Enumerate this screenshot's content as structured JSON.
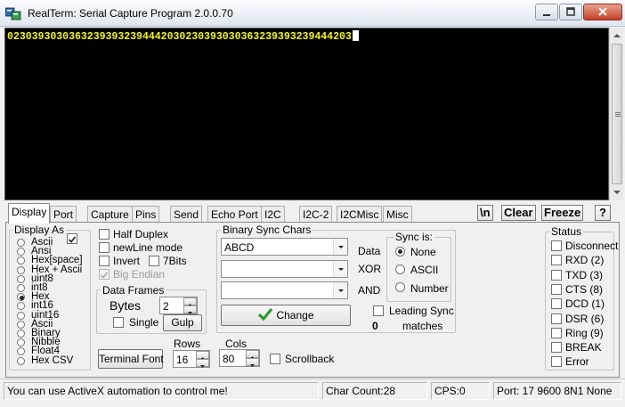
{
  "window": {
    "title": "RealTerm: Serial Capture Program 2.0.0.70"
  },
  "terminal": {
    "text": "02303930303632393932394442030230393030363239393239444203"
  },
  "tabs": [
    "Display",
    "Port",
    "Capture",
    "Pins",
    "Send",
    "Echo Port",
    "I2C",
    "I2C-2",
    "I2CMisc",
    "Misc"
  ],
  "toolbar": {
    "newline_label": "\\n",
    "clear_label": "Clear",
    "freeze_label": "Freeze",
    "help_label": "?"
  },
  "display_as": {
    "title": "Display As",
    "options": [
      "Ascii",
      "Ansi",
      "Hex[space]",
      "Hex + Ascii",
      "uint8",
      "int8",
      "Hex",
      "int16",
      "uint16",
      "Ascii",
      "Binary",
      "Nibble",
      "Float4",
      "Hex CSV"
    ],
    "selected": "Hex"
  },
  "options": {
    "half_duplex": "Half Duplex",
    "newline_mode": "newLine mode",
    "invert": "Invert",
    "seven_bits": "7Bits",
    "big_endian": "Big Endian"
  },
  "data_frames": {
    "title": "Data Frames",
    "bytes_label": "Bytes",
    "bytes_value": "2",
    "single_label": "Single",
    "gulp_label": "Gulp"
  },
  "binary_sync": {
    "title": "Binary Sync Chars",
    "data_value": "ABCD",
    "data_label": "Data",
    "xor_value": "",
    "xor_label": "XOR",
    "and_value": "",
    "and_label": "AND",
    "change_label": "Change",
    "sync_is_title": "Sync is:",
    "sync_options": [
      "None",
      "ASCII",
      "Number"
    ],
    "sync_selected": "None",
    "leading_sync_label": "Leading Sync",
    "matches_count": "0",
    "matches_label": "matches"
  },
  "terminal_font_label": "Terminal Font",
  "rows": {
    "label": "Rows",
    "value": "16"
  },
  "cols": {
    "label": "Cols",
    "value": "80"
  },
  "scrollback_label": "Scrollback",
  "status_group": {
    "title": "Status",
    "items": [
      "Disconnect",
      "RXD (2)",
      "TXD (3)",
      "CTS (8)",
      "DCD (1)",
      "DSR (6)",
      "Ring (9)",
      "BREAK",
      "Error"
    ]
  },
  "statusbar": {
    "message": "You can use ActiveX automation to control me!",
    "char_count": "Char Count:28",
    "cps": "CPS:0",
    "port": "Port: 17 9600 8N1 None"
  },
  "colors": {
    "terminal_bg": "#000000",
    "terminal_fg": "#f3f32a",
    "change_check": "#2e9a2e"
  }
}
